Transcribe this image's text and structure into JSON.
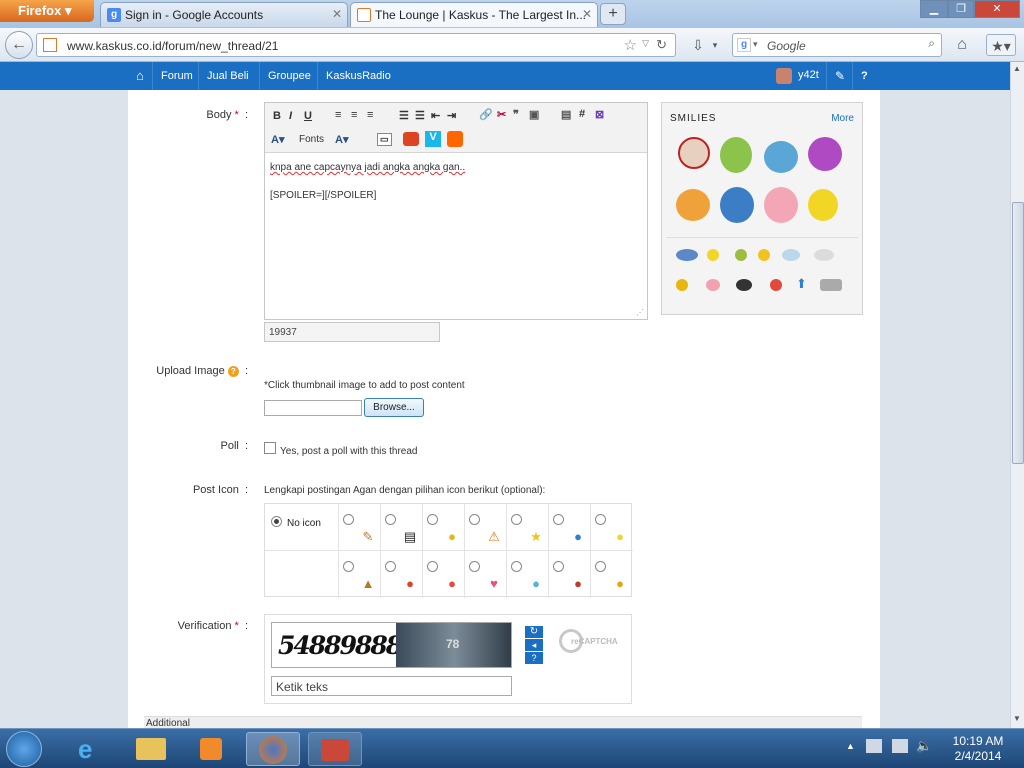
{
  "browser": {
    "app_button": "Firefox",
    "tabs": [
      {
        "title": "Sign in - Google Accounts",
        "icon": "google-icon"
      },
      {
        "title": "The Lounge | Kaskus - The Largest In...",
        "icon": "kaskus-icon"
      }
    ],
    "url": "www.kaskus.co.id/forum/new_thread/21",
    "search_placeholder": "Google"
  },
  "sitenav": {
    "items": [
      "Forum",
      "Jual Beli",
      "Groupee",
      "KaskusRadio"
    ],
    "username": "y42t"
  },
  "form": {
    "body_label": "Body",
    "editor_fonts": "Fonts",
    "body_text_line1": "knpa ane capcaynya jadi angka angka gan..",
    "body_text_line2": "[SPOILER=][/SPOILER]",
    "char_counter": "19937",
    "smilies_title": "SMILIES",
    "smilies_more": "More",
    "upload_label": "Upload Image",
    "upload_note": "*Click thumbnail image to add to post content",
    "browse_button": "Browse...",
    "poll_label": "Poll",
    "poll_option": "Yes, post a poll with this thread",
    "post_icon_label": "Post Icon",
    "post_icon_note": "Lengkapi postingan Agan dengan pilihan icon berikut (optional):",
    "no_icon": "No icon",
    "verification_label": "Verification",
    "captcha_text": "54889888",
    "captcha_image_text": "78",
    "captcha_placeholder": "Ketik teks",
    "recaptcha_brand": "reCAPTCHA",
    "additional": "Additional"
  },
  "taskbar": {
    "time": "10:19 AM",
    "date": "2/4/2014"
  },
  "colors": {
    "brand_blue": "#1b6fc2",
    "required": "#d0021b",
    "firefox_orange": "#e07a2a"
  }
}
